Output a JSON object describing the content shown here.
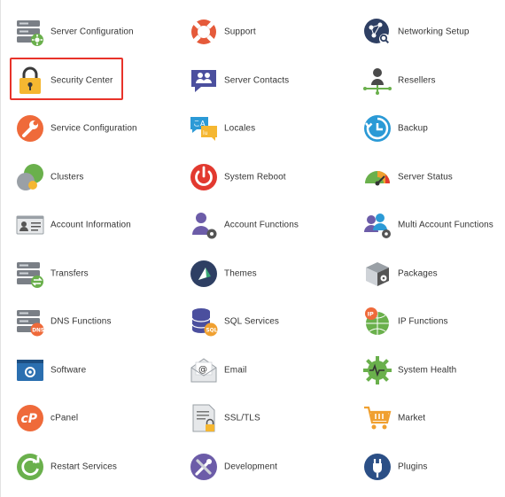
{
  "items": [
    {
      "label": "Server Configuration",
      "icon": "server-config-icon"
    },
    {
      "label": "Support",
      "icon": "lifebuoy-icon"
    },
    {
      "label": "Networking Setup",
      "icon": "network-icon"
    },
    {
      "label": "Security Center",
      "icon": "lock-icon"
    },
    {
      "label": "Server Contacts",
      "icon": "contacts-icon"
    },
    {
      "label": "Resellers",
      "icon": "resellers-icon"
    },
    {
      "label": "Service Configuration",
      "icon": "wrench-icon"
    },
    {
      "label": "Locales",
      "icon": "locales-icon"
    },
    {
      "label": "Backup",
      "icon": "backup-icon"
    },
    {
      "label": "Clusters",
      "icon": "clusters-icon"
    },
    {
      "label": "System Reboot",
      "icon": "power-icon"
    },
    {
      "label": "Server Status",
      "icon": "gauge-icon"
    },
    {
      "label": "Account Information",
      "icon": "account-card-icon"
    },
    {
      "label": "Account Functions",
      "icon": "user-gear-icon"
    },
    {
      "label": "Multi Account Functions",
      "icon": "multi-user-gear-icon"
    },
    {
      "label": "Transfers",
      "icon": "transfers-icon"
    },
    {
      "label": "Themes",
      "icon": "themes-icon"
    },
    {
      "label": "Packages",
      "icon": "package-icon"
    },
    {
      "label": "DNS Functions",
      "icon": "dns-icon"
    },
    {
      "label": "SQL Services",
      "icon": "database-icon"
    },
    {
      "label": "IP Functions",
      "icon": "ip-globe-icon"
    },
    {
      "label": "Software",
      "icon": "software-window-icon"
    },
    {
      "label": "Email",
      "icon": "email-icon"
    },
    {
      "label": "System Health",
      "icon": "system-health-icon"
    },
    {
      "label": "cPanel",
      "icon": "cpanel-icon"
    },
    {
      "label": "SSL/TLS",
      "icon": "ssl-document-icon"
    },
    {
      "label": "Market",
      "icon": "cart-icon"
    },
    {
      "label": "Restart Services",
      "icon": "restart-icon"
    },
    {
      "label": "Development",
      "icon": "development-tools-icon"
    },
    {
      "label": "Plugins",
      "icon": "plug-icon"
    }
  ],
  "selected_label": "Security Center",
  "colors": {
    "highlight": "#e8332a",
    "text": "#333333"
  }
}
